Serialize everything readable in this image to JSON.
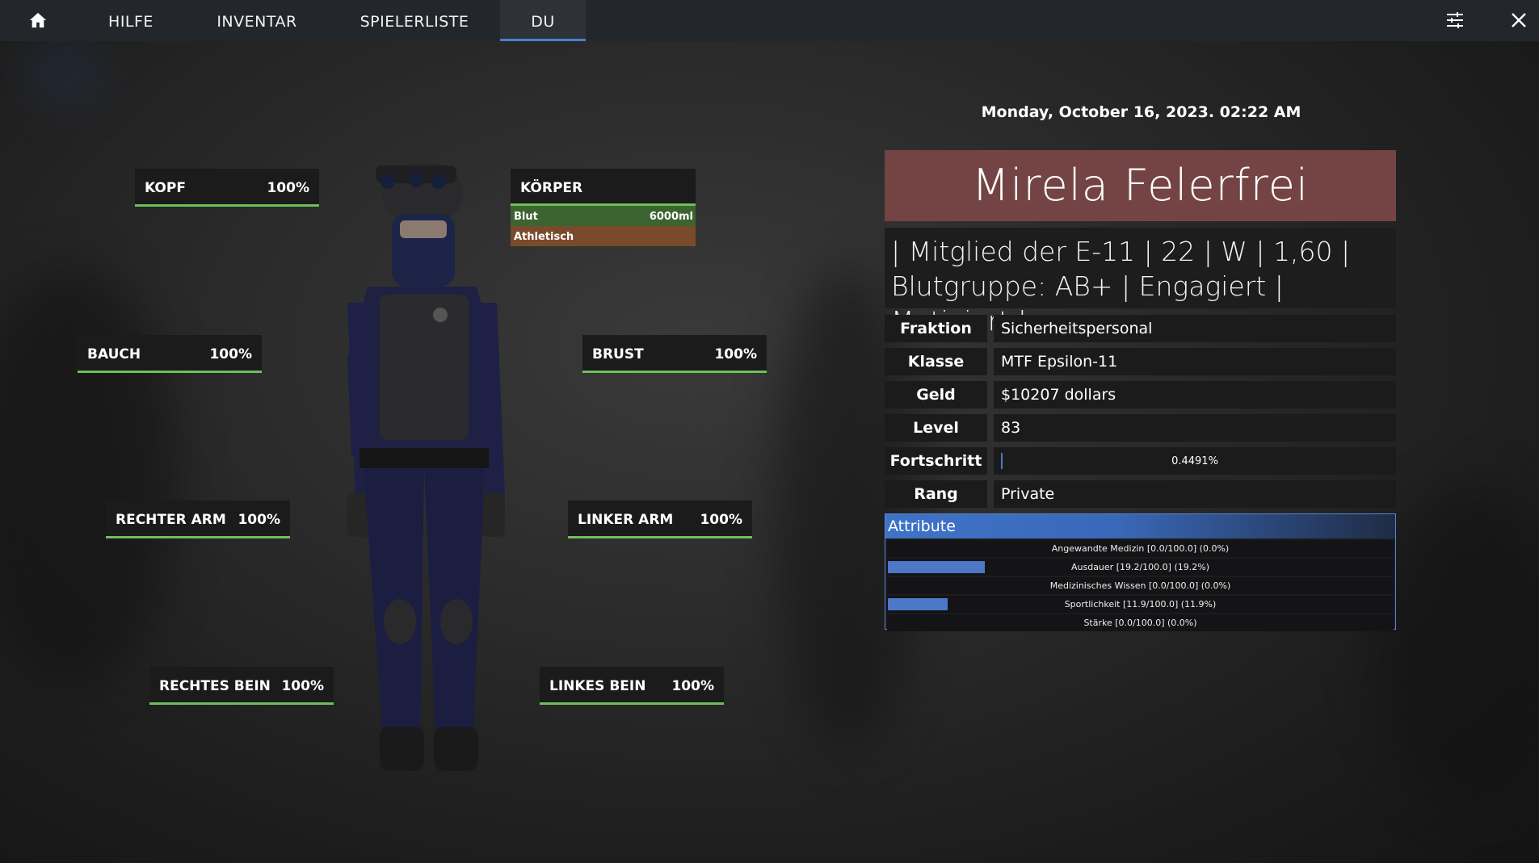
{
  "nav": {
    "home_icon": "home-icon",
    "tabs": [
      {
        "label": "HILFE"
      },
      {
        "label": "INVENTAR"
      },
      {
        "label": "SPIELERLISTE"
      },
      {
        "label": "DU"
      }
    ],
    "settings_icon": "sliders-icon",
    "close_icon": "close-icon"
  },
  "body_parts": {
    "kopf": {
      "label": "KOPF",
      "value": "100%"
    },
    "bauch": {
      "label": "BAUCH",
      "value": "100%"
    },
    "brust": {
      "label": "BRUST",
      "value": "100%"
    },
    "rechter_arm": {
      "label": "RECHTER ARM",
      "value": "100%"
    },
    "linker_arm": {
      "label": "LINKER ARM",
      "value": "100%"
    },
    "rechtes_bein": {
      "label": "RECHTES BEIN",
      "value": "100%"
    },
    "linkes_bein": {
      "label": "LINKES BEIN",
      "value": "100%"
    }
  },
  "koerper": {
    "title": "KÖRPER",
    "blood_label": "Blut",
    "blood_value": "6000ml",
    "trait": "Athletisch"
  },
  "profile": {
    "date": "Monday, October 16, 2023. 02:22 AM",
    "name": "Mirela Felerfrei",
    "bio_line1": "| Mitglied der E-11 | 22 | W | 1,60 |",
    "bio_line2": "Blutgruppe: AB+ | Engagiert | Motiviert |",
    "fields": [
      {
        "key": "Fraktion",
        "value": "Sicherheitspersonal"
      },
      {
        "key": "Klasse",
        "value": "MTF Epsilon-11"
      },
      {
        "key": "Geld",
        "value": "$10207 dollars"
      },
      {
        "key": "Level",
        "value": "83"
      },
      {
        "key": "Rang",
        "value": "Private"
      }
    ],
    "progress": {
      "key": "Fortschritt",
      "text": "0.4491%",
      "fraction": 0.004491
    }
  },
  "attributes": {
    "title": "Attribute",
    "items": [
      {
        "text": "Angewandte Medizin [0.0/100.0] (0.0%)",
        "fraction": 0.0
      },
      {
        "text": "Ausdauer [19.2/100.0] (19.2%)",
        "fraction": 0.192
      },
      {
        "text": "Medizinisches Wissen [0.0/100.0] (0.0%)",
        "fraction": 0.0
      },
      {
        "text": "Sportlichkeit [11.9/100.0] (11.9%)",
        "fraction": 0.119
      },
      {
        "text": "Stärke [0.0/100.0] (0.0%)",
        "fraction": 0.0
      }
    ]
  },
  "colors": {
    "health_bar": "#6fbf59",
    "accent_blue": "#4a7fcc",
    "name_banner": "#744444",
    "blood_row": "#3c6430",
    "trait_row": "#7a4a2c"
  }
}
